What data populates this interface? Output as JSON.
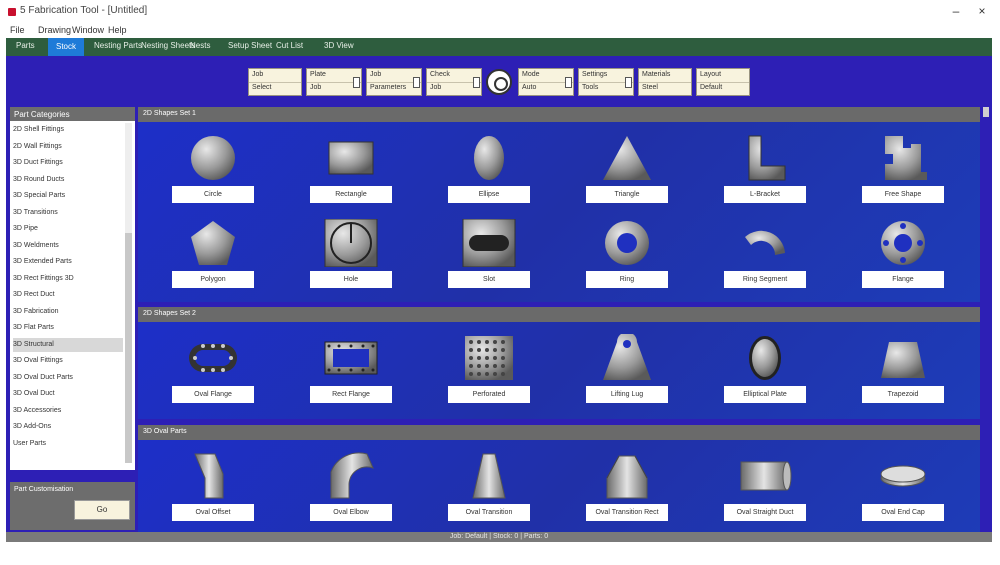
{
  "window": {
    "title": "5 Fabrication Tool - [Untitled]",
    "controls": [
      "–",
      "×"
    ]
  },
  "menu": [
    "File",
    "Drawing",
    "Window",
    "Help"
  ],
  "tabs": [
    {
      "label": "Parts"
    },
    {
      "label": "Stock",
      "active": true
    },
    {
      "label": "Nesting Parts"
    },
    {
      "label": "Nesting Sheets"
    },
    {
      "label": "Nests"
    },
    {
      "label": "Setup Sheet"
    },
    {
      "label": "Cut List"
    },
    {
      "label": "3D View"
    }
  ],
  "toolbar": {
    "fields": [
      {
        "line1": "Job",
        "line2": "Select"
      },
      {
        "line1": "Plate",
        "line2": "Job"
      },
      {
        "line1": "Job",
        "line2": "Parameters"
      },
      {
        "line1": "Check",
        "line2": "Job"
      },
      {
        "line1": "Mode",
        "line2": "Auto"
      },
      {
        "line1": "Settings",
        "line2": "Tools"
      },
      {
        "line1": "Materials",
        "line2": "Steel"
      },
      {
        "line1": "Layout",
        "line2": "Default"
      }
    ]
  },
  "sidebar": {
    "header": "Part Categories",
    "items": [
      "2D Shell Fittings",
      "2D Wall Fittings",
      "3D Duct Fittings",
      "3D Round Ducts",
      "3D Special Parts",
      "3D Transitions",
      "3D Pipe",
      "3D Weldments",
      "3D Extended Parts",
      "3D Rect Fittings 3D",
      "3D Rect Duct",
      "3D Fabrication",
      "3D Flat Parts",
      "3D Structural",
      "3D Oval Fittings",
      "3D Oval Duct Parts",
      "3D Oval Duct",
      "3D Accessories",
      "3D Add-Ons",
      "User Parts"
    ],
    "selected_index": 13,
    "footer_label": "Part Customisation",
    "footer_button": "Go"
  },
  "panels": [
    {
      "title": "2D Shapes Set 1",
      "tiles": [
        {
          "label": "Circle",
          "icon": "circle-shape"
        },
        {
          "label": "Rectangle",
          "icon": "rectangle-shape"
        },
        {
          "label": "Ellipse",
          "icon": "ellipse-shape"
        },
        {
          "label": "Triangle",
          "icon": "triangle-shape"
        },
        {
          "label": "L-Bracket",
          "icon": "l-shape"
        },
        {
          "label": "Free Shape",
          "icon": "notch-shape"
        },
        {
          "label": "Polygon",
          "icon": "polygon-shape"
        },
        {
          "label": "Hole",
          "icon": "hole-shape"
        },
        {
          "label": "Slot",
          "icon": "slot-shape"
        },
        {
          "label": "Ring",
          "icon": "ring-shape"
        },
        {
          "label": "Ring Segment",
          "icon": "ring-segment-shape"
        },
        {
          "label": "Flange",
          "icon": "flange-shape"
        }
      ]
    },
    {
      "title": "2D Shapes Set 2",
      "tiles": [
        {
          "label": "Oval Flange",
          "icon": "oval-flange-shape"
        },
        {
          "label": "Rect Flange",
          "icon": "rect-flange-shape"
        },
        {
          "label": "Perforated",
          "icon": "perforated-shape"
        },
        {
          "label": "Lifting Lug",
          "icon": "lug-shape"
        },
        {
          "label": "Elliptical Plate",
          "icon": "elliptical-shape"
        },
        {
          "label": "Trapezoid",
          "icon": "trapezoid-shape"
        }
      ]
    },
    {
      "title": "3D Oval Parts",
      "tiles": [
        {
          "label": "Oval Offset",
          "icon": "offset-shape"
        },
        {
          "label": "Oval Elbow",
          "icon": "elbow-shape"
        },
        {
          "label": "Oval Transition",
          "icon": "transition-shape"
        },
        {
          "label": "Oval Transition Rect",
          "icon": "transition-rect-shape"
        },
        {
          "label": "Oval Straight Duct",
          "icon": "straight-duct-shape"
        },
        {
          "label": "Oval End Cap",
          "icon": "end-cap-shape"
        }
      ]
    }
  ],
  "status": "Job: Default   |   Stock: 0   |   Parts: 0",
  "colors": {
    "background": "#2d1fb5",
    "tabbar": "#2e5d3e",
    "active_tab": "#1e7bd8",
    "panel_header": "#6a6a6a",
    "field_bg": "#f8f3de"
  }
}
